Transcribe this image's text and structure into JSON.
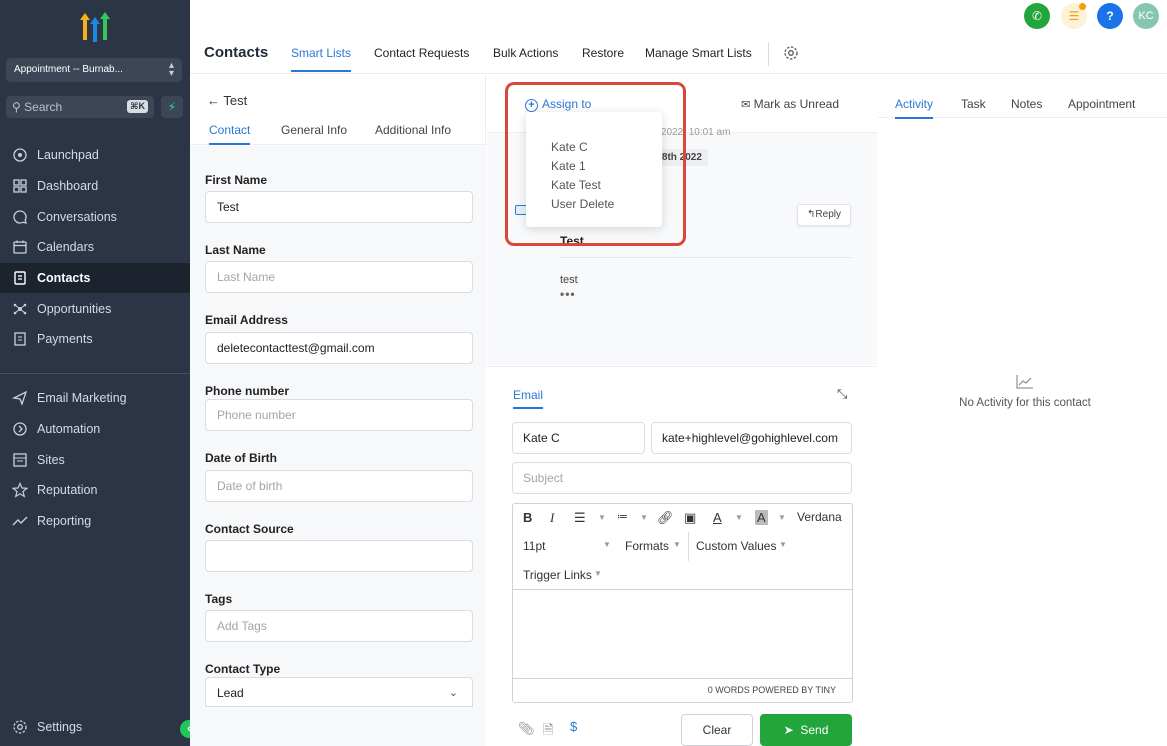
{
  "sidebar": {
    "account": "Appointment -- Burnab...",
    "search_placeholder": "Search",
    "search_shortcut": "⌘K",
    "items": [
      {
        "label": "Launchpad"
      },
      {
        "label": "Dashboard"
      },
      {
        "label": "Conversations"
      },
      {
        "label": "Calendars"
      },
      {
        "label": "Contacts"
      },
      {
        "label": "Opportunities"
      },
      {
        "label": "Payments"
      },
      {
        "label": "Email Marketing"
      },
      {
        "label": "Automation"
      },
      {
        "label": "Sites"
      },
      {
        "label": "Reputation"
      },
      {
        "label": "Reporting"
      },
      {
        "label": "Settings"
      }
    ],
    "active_index": 4
  },
  "topbar": {
    "avatar_initials": "KC",
    "colors": {
      "phone": "#22a53a",
      "help": "#1a73e8",
      "avatar": "#86c6b1"
    }
  },
  "header": {
    "title": "Contacts",
    "tabs": [
      "Smart Lists",
      "Contact Requests",
      "Bulk Actions",
      "Restore",
      "Manage Smart Lists"
    ]
  },
  "contact": {
    "back_label": "Test",
    "subtabs": [
      "Contact",
      "General Info",
      "Additional Info"
    ],
    "fields": {
      "first_name": {
        "label": "First Name",
        "value": "Test"
      },
      "last_name": {
        "label": "Last Name",
        "placeholder": "Last Name"
      },
      "email": {
        "label": "Email Address",
        "value": "deletecontacttest@gmail.com"
      },
      "phone": {
        "label": "Phone number",
        "placeholder": "Phone number"
      },
      "dob": {
        "label": "Date of Birth",
        "placeholder": "Date of birth"
      },
      "source": {
        "label": "Contact Source",
        "value": ""
      },
      "tags": {
        "label": "Tags",
        "placeholder": "Add Tags"
      },
      "type": {
        "label": "Contact Type",
        "value": "Lead"
      }
    }
  },
  "conversation": {
    "assign_label": "Assign to",
    "mark_unread_label": "Mark as Unread",
    "assign_options": [
      "Kate C",
      "Kate 1",
      "Kate Test",
      "User Delete"
    ],
    "message_date_partial": "08 2022, 10:01 am",
    "message_date_badge": "b 8th 2022",
    "reply_label": "Reply",
    "message_subject": "Test",
    "message_body": "test",
    "message_more": "•••"
  },
  "composer": {
    "tab": "Email",
    "from_name": "Kate C",
    "from_email": "kate+highlevel@gohighlevel.com",
    "subject_placeholder": "Subject",
    "font_name": "Verdana",
    "font_size": "11pt",
    "formats_label": "Formats",
    "custom_values_label": "Custom Values",
    "trigger_links_label": "Trigger Links",
    "word_count": "0 WORDS POWERED BY TINY",
    "clear_label": "Clear",
    "send_label": "Send"
  },
  "activity": {
    "tabs": [
      "Activity",
      "Task",
      "Notes",
      "Appointment"
    ],
    "empty_text": "No Activity for this contact"
  }
}
